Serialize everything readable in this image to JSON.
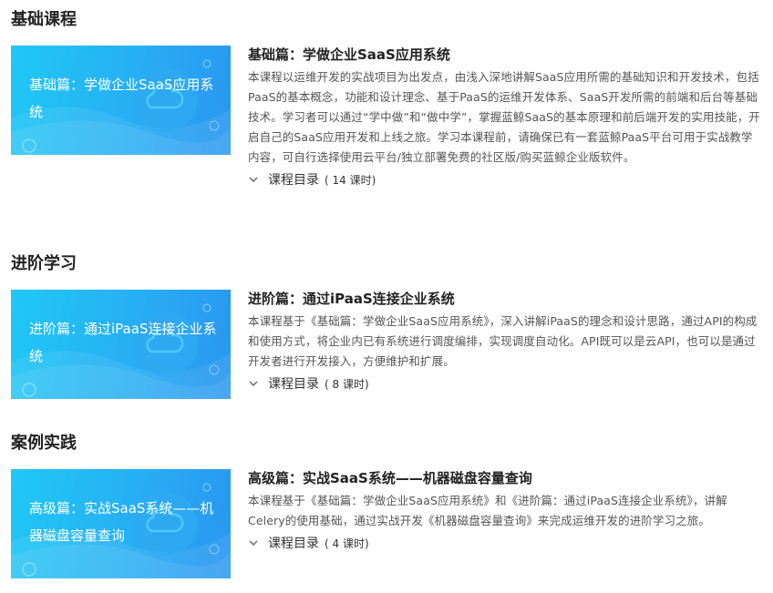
{
  "sections": [
    {
      "title": "基础课程",
      "course": {
        "thumb_title": "基础篇：学做企业SaaS应用系统",
        "title": "基础篇：学做企业SaaS应用系统",
        "description": "本课程以运维开发的实战项目为出发点，由浅入深地讲解SaaS应用所需的基础知识和开发技术，包括PaaS的基本概念，功能和设计理念、基于PaaS的运维开发体系、SaaS开发所需的前端和后台等基础技术。学习者可以通过“学中做”和“做中学”，掌握蓝鲸SaaS的基本原理和前后端开发的实用技能，开启自己的SaaS应用开发和上线之旅。学习本课程前，请确保已有一套蓝鲸PaaS平台可用于实战教学内容，可自行选择使用云平台/独立部署免费的社区版/购买蓝鲸企业版软件。",
        "toc_label": "课程目录",
        "lesson_count": "( 14 课时)"
      }
    },
    {
      "title": "进阶学习",
      "course": {
        "thumb_title": "进阶篇：通过iPaaS连接企业系统",
        "title": "进阶篇：通过iPaaS连接企业系统",
        "description": "本课程基于《基础篇：学做企业SaaS应用系统》，深入讲解iPaaS的理念和设计思路，通过API的构成和使用方式，将企业内已有系统进行调度编排，实现调度自动化。API既可以是云API，也可以是通过开发者进行开发接入，方便维护和扩展。",
        "toc_label": "课程目录",
        "lesson_count": "( 8 课时)"
      }
    },
    {
      "title": "案例实践",
      "course": {
        "thumb_title": "高级篇：实战SaaS系统——机器磁盘容量查询",
        "title": "高级篇：实战SaaS系统——机器磁盘容量查询",
        "description": "本课程基于《基础篇：学做企业SaaS应用系统》和《进阶篇：通过iPaaS连接企业系统》，讲解Celery的使用基础，通过实战开发《机器磁盘容量查询》来完成运维开发的进阶学习之旅。",
        "toc_label": "课程目录",
        "lesson_count": "( 4 课时)"
      }
    }
  ],
  "colors": {
    "thumb_gradient_start": "#1fc8f5",
    "thumb_gradient_end": "#2a96f0",
    "heading": "#222222",
    "body_text": "#555555"
  },
  "icons": {
    "thumb_emblem": "cloud-icon",
    "toc_toggle": "chevron-down-icon"
  }
}
